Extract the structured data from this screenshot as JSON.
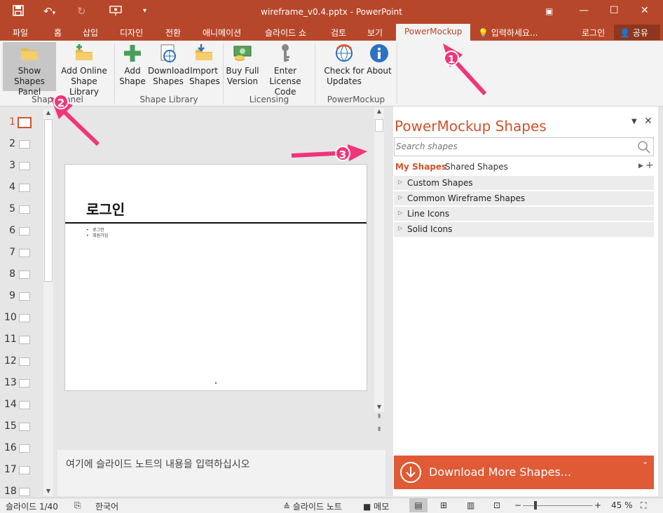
{
  "window": {
    "title": "wireframe_v0.4.pptx - PowerPoint"
  },
  "tabs": [
    "파일",
    "홈",
    "삽입",
    "디자인",
    "전환",
    "애니메이션",
    "슬라이드 쇼",
    "검토",
    "보기",
    "PowerMockup"
  ],
  "tellme": "입력하세요...",
  "login": "로그인",
  "share": "공유",
  "ribbon": {
    "buttons": [
      "Show Shapes Panel",
      "Add Online Shape Library",
      "Add Shape",
      "Download Shapes",
      "Import Shapes",
      "Buy Full Version",
      "Enter License Code",
      "Check for Updates",
      "About"
    ],
    "groups": [
      "Shape Panel",
      "Shape Library",
      "Licensing",
      "PowerMockup"
    ]
  },
  "slides": [
    "1",
    "2",
    "3",
    "4",
    "5",
    "6",
    "7",
    "8",
    "9",
    "10",
    "11",
    "12",
    "13",
    "14",
    "15",
    "16",
    "17",
    "18"
  ],
  "slide": {
    "title": "로그인",
    "bullets": [
      "로그인",
      "회원가입"
    ]
  },
  "notes_placeholder": "여기에 슬라이드 노트의 내용을 입력하십시오",
  "panel": {
    "title": "PowerMockup Shapes",
    "search_placeholder": "Search shapes",
    "tab_my": "My Shapes",
    "tab_shared": "Shared Shapes",
    "categories": [
      "Custom Shapes",
      "Common Wireframe Shapes",
      "Line Icons",
      "Solid Icons"
    ],
    "download": "Download More Shapes..."
  },
  "status": {
    "slide": "슬라이드 1/40",
    "language": "한국어",
    "notes": "슬라이드 노트",
    "comments": "메모",
    "zoom": "45 %"
  },
  "annotations": [
    "1",
    "2",
    "3"
  ],
  "colors": {
    "accent": "#b7472a",
    "panel_title": "#d0532b",
    "download_bg": "#e05a35",
    "badge": "#f0357a"
  }
}
